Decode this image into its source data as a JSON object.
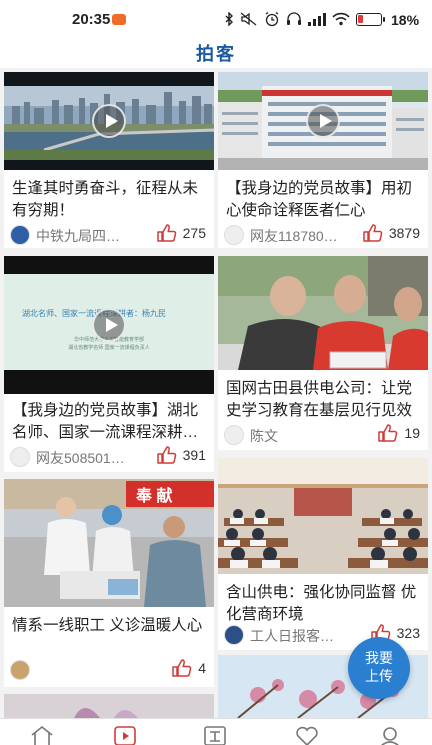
{
  "status_bar": {
    "time": "20:35",
    "battery_percent": "18%",
    "battery_level": 0.18,
    "icons": [
      "bluetooth-icon",
      "mute-icon",
      "alarm-icon",
      "headset-icon",
      "signal-icon",
      "wifi-icon",
      "battery-icon"
    ]
  },
  "header": {
    "title": "拍客"
  },
  "feed": {
    "cards": [
      {
        "title": "生逢其时勇奋斗，征程从未有穷期！",
        "author": "中铁九局四…",
        "likes": "275",
        "has_video": true
      },
      {
        "title": "【我身边的党员故事】用初心使命诠释医者仁心",
        "author": "网友118780…",
        "likes": "3879",
        "has_video": true
      },
      {
        "title": "【我身边的党员故事】湖北名师、国家一流课程深耕…",
        "author": "网友508501…",
        "likes": "391",
        "has_video": true,
        "thumb_text": {
          "headline": "湖北名师、国家一流课程深耕者：杨九民",
          "line1": "华中师范大学人工智能教育学部",
          "line2": "湖北省教学名师 国家一流课程负责人"
        }
      },
      {
        "title": "国网古田县供电公司：让党史学习教育在基层见行见效",
        "author": "陈文",
        "likes": "19",
        "has_video": false
      },
      {
        "title": "情系一线职工 义诊温暖人心",
        "author": "",
        "likes": "4",
        "has_video": false,
        "thumb_text": {
          "banner": "奉 献"
        }
      },
      {
        "title": "含山供电：强化协同监督 优化营商环境",
        "author": "工人日报客…",
        "likes": "323",
        "has_video": false
      }
    ]
  },
  "upload_button": {
    "line1": "我要",
    "line2": "上传"
  },
  "tab_bar": {
    "items": [
      "home-icon",
      "video-icon",
      "workers-icon",
      "heart-icon",
      "user-icon"
    ]
  },
  "colors": {
    "accent": "#1b5a9e",
    "like": "#d23a3a",
    "fab": "#2b7fd0"
  }
}
